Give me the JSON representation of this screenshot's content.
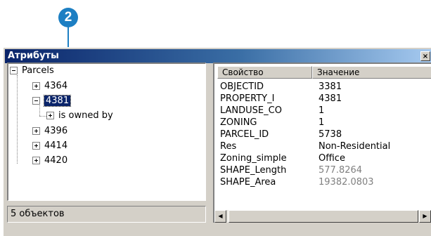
{
  "callout": {
    "number": "2"
  },
  "window": {
    "title": "Атрибуты",
    "close_label": "×"
  },
  "tree": {
    "root": "Parcels",
    "items": [
      {
        "label": "4364"
      },
      {
        "label": "4381",
        "selected": true,
        "child": "is owned by"
      },
      {
        "label": "4396"
      },
      {
        "label": "4414"
      },
      {
        "label": "4420"
      }
    ]
  },
  "status": {
    "text": "5 объектов"
  },
  "grid": {
    "headers": {
      "property": "Свойство",
      "value": "Значение"
    },
    "rows": [
      {
        "property": "OBJECTID",
        "value": "3381"
      },
      {
        "property": "PROPERTY_I",
        "value": "4381"
      },
      {
        "property": "LANDUSE_CO",
        "value": "1"
      },
      {
        "property": "ZONING",
        "value": "1"
      },
      {
        "property": "PARCEL_ID",
        "value": "5738"
      },
      {
        "property": "Res",
        "value": "Non-Residential"
      },
      {
        "property": "Zoning_simple",
        "value": "Office"
      },
      {
        "property": "SHAPE_Length",
        "value": "577.8264",
        "dim": true
      },
      {
        "property": "SHAPE_Area",
        "value": "19382.0803",
        "dim": true
      }
    ]
  },
  "scroll": {
    "left_arrow": "◀",
    "right_arrow": "▶"
  }
}
